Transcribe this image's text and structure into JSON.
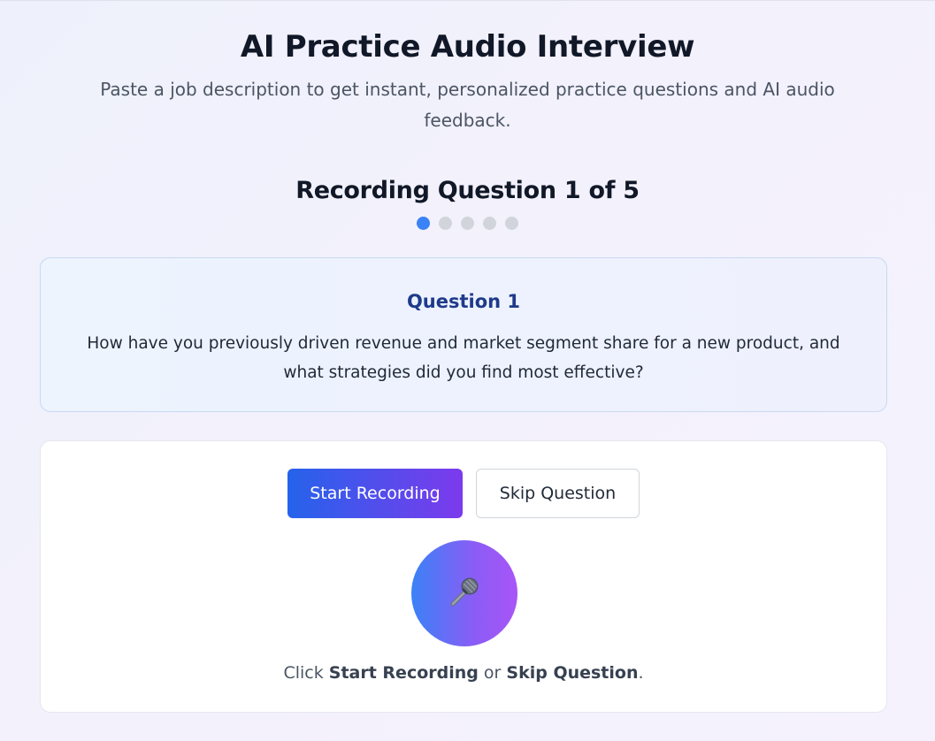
{
  "header": {
    "title": "AI Practice Audio Interview",
    "subtitle": "Paste a job description to get instant, personalized practice questions and AI audio feedback."
  },
  "progress": {
    "title": "Recording Question 1 of 5",
    "current": 1,
    "total": 5
  },
  "question": {
    "label": "Question 1",
    "text": "How have you previously driven revenue and market segment share for a new product, and what strategies did you find most effective?"
  },
  "recorder": {
    "start_label": "Start Recording",
    "skip_label": "Skip Question",
    "mic_icon": "microphone-icon",
    "hint_prefix": "Click ",
    "hint_start": "Start Recording",
    "hint_or": " or ",
    "hint_skip": "Skip Question",
    "hint_suffix": "."
  },
  "colors": {
    "accent": "#3b82f6",
    "accent_purple": "#7c3aed",
    "question_title": "#1e3a8a"
  }
}
